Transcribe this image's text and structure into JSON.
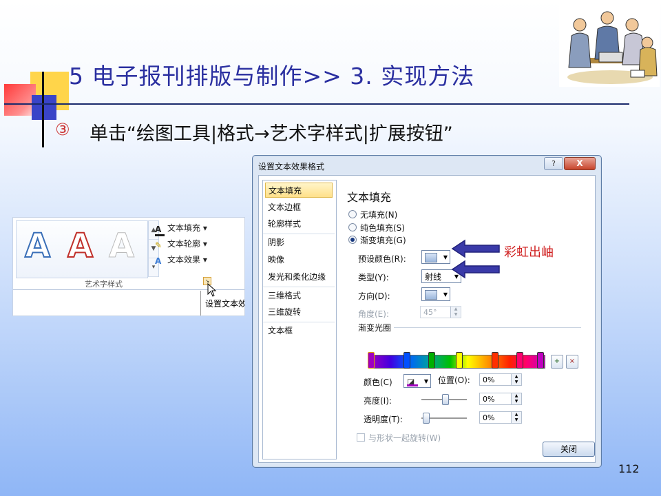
{
  "slide": {
    "title": "5 电子报刊排版与制作>> 3. 实现方法",
    "bullet_num": "③",
    "bullet_text": "单击“绘图工具|格式→艺术字样式|扩展按钮”",
    "page_number": "112",
    "annotation": "彩虹出岫"
  },
  "ribbon": {
    "menu": [
      "文本填充",
      "文本轮廓",
      "文本效果"
    ],
    "group_label": "艺术字样式",
    "tooltip": "设置文本效"
  },
  "dialog": {
    "title": "设置文本效果格式",
    "help_label": "?",
    "close_label": "X",
    "nav": [
      "文本填充",
      "文本边框",
      "轮廓样式",
      "阴影",
      "映像",
      "发光和柔化边缘",
      "三维格式",
      "三维旋转",
      "文本框"
    ],
    "pane_heading": "文本填充",
    "radios": [
      "无填充(N)",
      "纯色填充(S)",
      "渐变填充(G)"
    ],
    "preset_label": "预设颜色(R):",
    "type_label": "类型(Y):",
    "type_value": "射线",
    "direction_label": "方向(D):",
    "angle_label": "角度(E):",
    "angle_value": "45°",
    "stops_label": "渐变光圈",
    "color_label": "颜色(C)",
    "position_label": "位置(O):",
    "position_value": "0%",
    "brightness_label": "亮度(I):",
    "brightness_value": "0%",
    "transparency_label": "透明度(T):",
    "transparency_value": "0%",
    "rotate_label": "与形状一起旋转(W)",
    "close_button": "关闭"
  }
}
